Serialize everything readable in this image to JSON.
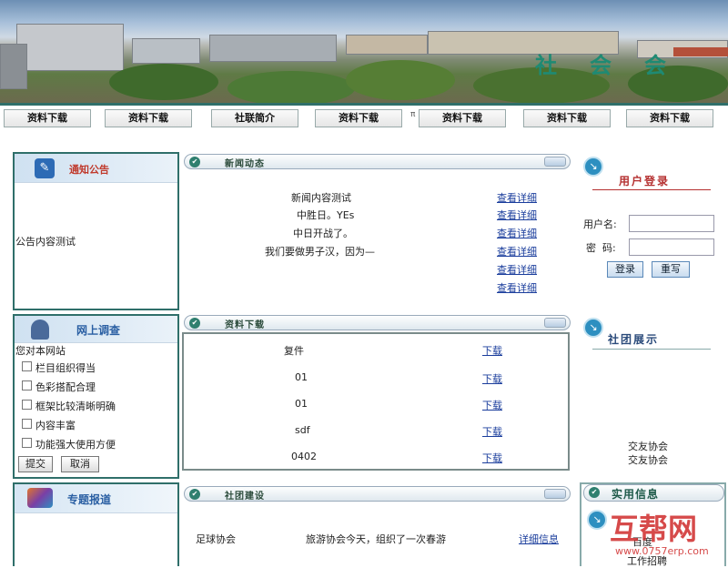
{
  "banner": {
    "seal_chars": [
      "社",
      "会",
      "会"
    ]
  },
  "nav": {
    "items": [
      "资料下载",
      "资料下载",
      "社联简介",
      "资料下载",
      "资料下载",
      "资料下载",
      "资料下载"
    ],
    "separator": "π"
  },
  "notice": {
    "title": "通知公告",
    "content": "公告内容测试"
  },
  "survey": {
    "title": "网上调查",
    "question": "您对本网站",
    "options": [
      "栏目组织得当",
      "色彩搭配合理",
      "框架比较清晰明确",
      "内容丰富",
      "功能强大使用方便"
    ],
    "submit": "提交",
    "cancel": "取消"
  },
  "special": {
    "title": "专题报道"
  },
  "news": {
    "title": "新闻动态",
    "items": [
      {
        "text": "新闻内容测试",
        "link": "查看详细"
      },
      {
        "text": "中胜日。YEs",
        "link": "查看详细"
      },
      {
        "text": "中日开战了。",
        "link": "查看详细"
      },
      {
        "text": "我们要做男子汉，因为—",
        "link": "查看详细"
      },
      {
        "text": "",
        "link": "查看详细"
      },
      {
        "text": "",
        "link": "查看详细"
      }
    ]
  },
  "downloads": {
    "title": "资料下载",
    "items": [
      {
        "name": "复件",
        "link": "下载"
      },
      {
        "name": "01",
        "link": "下载"
      },
      {
        "name": "01",
        "link": "下载"
      },
      {
        "name": "sdf",
        "link": "下载"
      },
      {
        "name": "0402",
        "link": "下载"
      }
    ]
  },
  "club": {
    "title": "社团建设",
    "row": {
      "name": "足球协会",
      "desc": "旅游协会今天，组织了一次春游",
      "link": "详细信息"
    }
  },
  "login": {
    "title": "用户登录",
    "username_label": "用户名:",
    "password_label": "密  码:",
    "login_btn": "登录",
    "reset_btn": "重写"
  },
  "showcase": {
    "title": "社团展示",
    "items": [
      "交友协会",
      "交友协会"
    ]
  },
  "useful": {
    "title": "实用信息",
    "items": [
      "百度",
      "工作招聘"
    ]
  },
  "watermark": {
    "text": "互帮网",
    "url": "www.0757erp.com"
  }
}
